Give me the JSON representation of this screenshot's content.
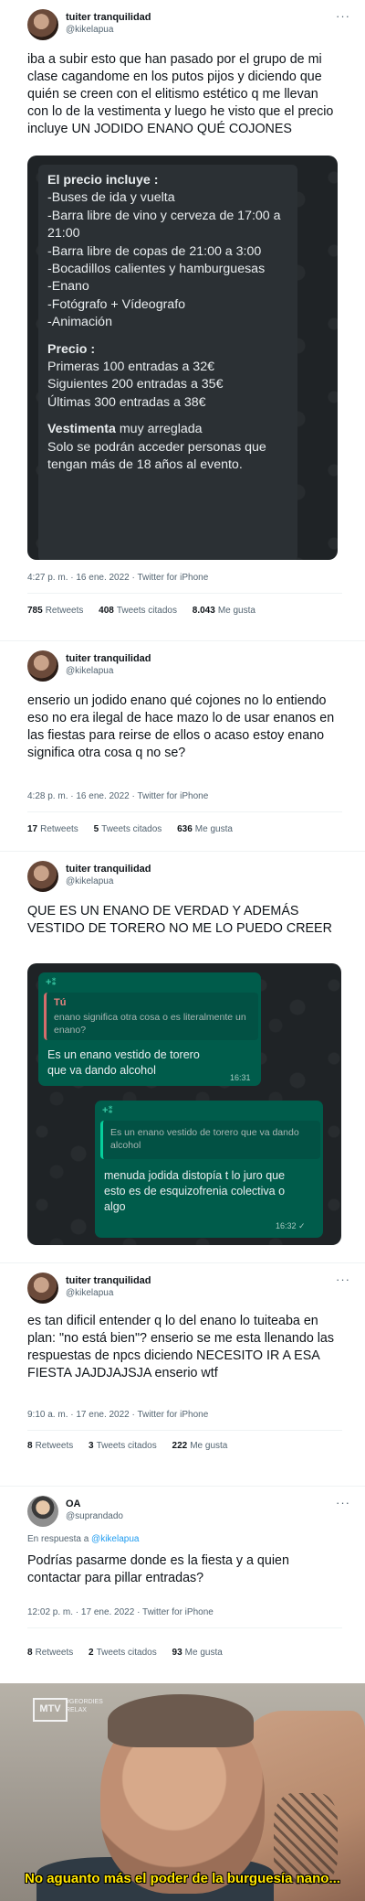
{
  "tweets": [
    {
      "user": "tuiter tranquilidad",
      "handle": "@kikelapua",
      "text": "iba a subir esto que han pasado por el grupo de mi clase cagandome en los putos pijos y diciendo que quién se creen con el elitismo estético q me llevan con lo de la vestimenta y luego he visto que el precio incluye UN JODIDO ENANO QUÉ COJONES",
      "image": {
        "header": "El precio incluye :",
        "items": [
          "-Buses de ida y vuelta",
          "-Barra libre de vino y cerveza de 17:00 a 21:00",
          "-Barra libre de copas de 21:00 a 3:00",
          "-Bocadillos calientes y hamburguesas",
          "-Enano",
          "-Fotógrafo + Vídeografo",
          "-Animación"
        ],
        "price_header": "Precio :",
        "prices": [
          "Primeras 100 entradas a 32€",
          "Siguientes 200 entradas a 35€",
          "Últimas 300 entradas a 38€"
        ],
        "dress_header": "Vestimenta",
        "dress_value": " muy arreglada",
        "dress_note": "Solo se podrán acceder personas que tengan más de 18 años al evento."
      },
      "time": "4:27 p. m. · 16 ene. 2022 · Twitter for iPhone",
      "retweets": "785",
      "retweets_label": "Retweets",
      "quotes": "408",
      "quotes_label": "Tweets citados",
      "likes": "8.043",
      "likes_label": "Me gusta"
    },
    {
      "user": "tuiter tranquilidad",
      "handle": "@kikelapua",
      "text": "enserio un jodido enano qué cojones no lo entiendo eso no era ilegal de hace mazo lo de usar enanos en las fiestas para reirse de ellos o acaso estoy enano significa otra cosa q no se?",
      "time": "4:28 p. m. · 16 ene. 2022 · Twitter for iPhone",
      "retweets": "17",
      "retweets_label": "Retweets",
      "quotes": "5",
      "quotes_label": "Tweets citados",
      "likes": "636",
      "likes_label": "Me gusta"
    },
    {
      "user": "tuiter tranquilidad",
      "handle": "@kikelapua",
      "text": "QUE ES UN ENANO DE VERDAD Y ADEMÁS VESTIDO DE TORERO NO ME LO PUEDO CREER",
      "chat": {
        "quote1_name": "Tú",
        "quote1_text": "enano significa otra cosa o es literalmente un enano?",
        "msg1": "Es un enano vestido de torero que va dando alcohol",
        "msg1_time": "16:31",
        "quote2_text": "Es un enano vestido de torero que va dando alcohol",
        "msg2": "menuda jodida distopía t lo juro que esto es de esquizofrenia colectiva o algo",
        "msg2_time": "16:32 ✓"
      }
    },
    {
      "user": "tuiter tranquilidad",
      "handle": "@kikelapua",
      "text": "es tan dificil entender q lo del enano lo tuiteaba en plan: \"no está bien\"? enserio se me esta llenando las respuestas de npcs diciendo NECESITO IR A ESA FIESTA JAJDJAJSJA enserio wtf",
      "time": "9:10 a. m. · 17 ene. 2022 · Twitter for iPhone",
      "retweets": "8",
      "retweets_label": "Retweets",
      "quotes": "3",
      "quotes_label": "Tweets citados",
      "likes": "222",
      "likes_label": "Me gusta"
    },
    {
      "user": "OA",
      "handle": "@suprandado",
      "reply_prefix": "En respuesta a",
      "reply_to": "@kikelapua",
      "text": "Podrías pasarme donde es la fiesta y a quien contactar para pillar entradas?",
      "time": "12:02 p. m. · 17 ene. 2022 · Twitter for iPhone",
      "retweets": "8",
      "retweets_label": "Retweets",
      "quotes": "2",
      "quotes_label": "Tweets citados",
      "likes": "93",
      "likes_label": "Me gusta"
    }
  ],
  "more_icon": "···",
  "meme": {
    "logo": "MTV",
    "logo_sub": "#GEORDIES\nRELAX",
    "subtitle": "No aguanto más el poder de la burguesía nano..."
  }
}
